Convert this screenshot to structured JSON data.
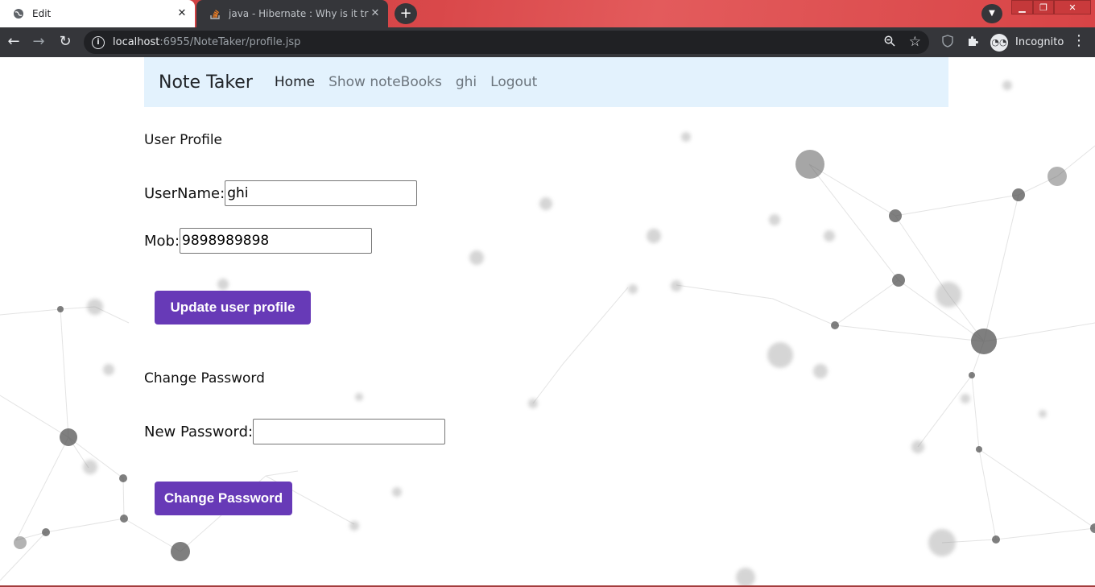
{
  "browser": {
    "tabs": [
      {
        "title": "Edit",
        "active": true
      },
      {
        "title": "java - Hibernate : Why is it trying",
        "active": false
      }
    ],
    "url_host": "localhost",
    "url_rest": ":6955/NoteTaker/profile.jsp",
    "profile_label": "Incognito",
    "colors": {
      "tabbar": "#d84446",
      "toolbar": "#35363a"
    }
  },
  "navbar": {
    "brand": "Note Taker",
    "links": [
      {
        "label": "Home",
        "active": true
      },
      {
        "label": "Show noteBooks",
        "active": false
      },
      {
        "label": "ghi",
        "active": false
      },
      {
        "label": "Logout",
        "active": false
      }
    ],
    "background": "#e3f2fd"
  },
  "profile": {
    "heading": "User Profile",
    "username_label": "UserName:",
    "username_value": "ghi",
    "mob_label": "Mob:",
    "mob_value": "9898989898",
    "update_button": "Update user profile"
  },
  "password": {
    "heading": "Change Password",
    "new_password_label": "New Password:",
    "new_password_value": "",
    "change_button": "Change Password"
  },
  "accent_color": "#673ab7"
}
